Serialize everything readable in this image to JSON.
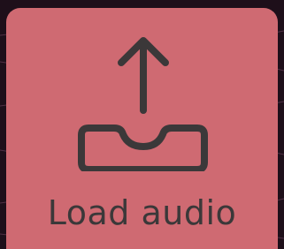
{
  "load_button": {
    "label": "Load audio",
    "icon": "upload-tray-icon"
  },
  "colors": {
    "background": "#1e0f1a",
    "background_lines": "#7a4b67",
    "card_fill": "#cf6a72",
    "foreground": "#3b3839"
  }
}
